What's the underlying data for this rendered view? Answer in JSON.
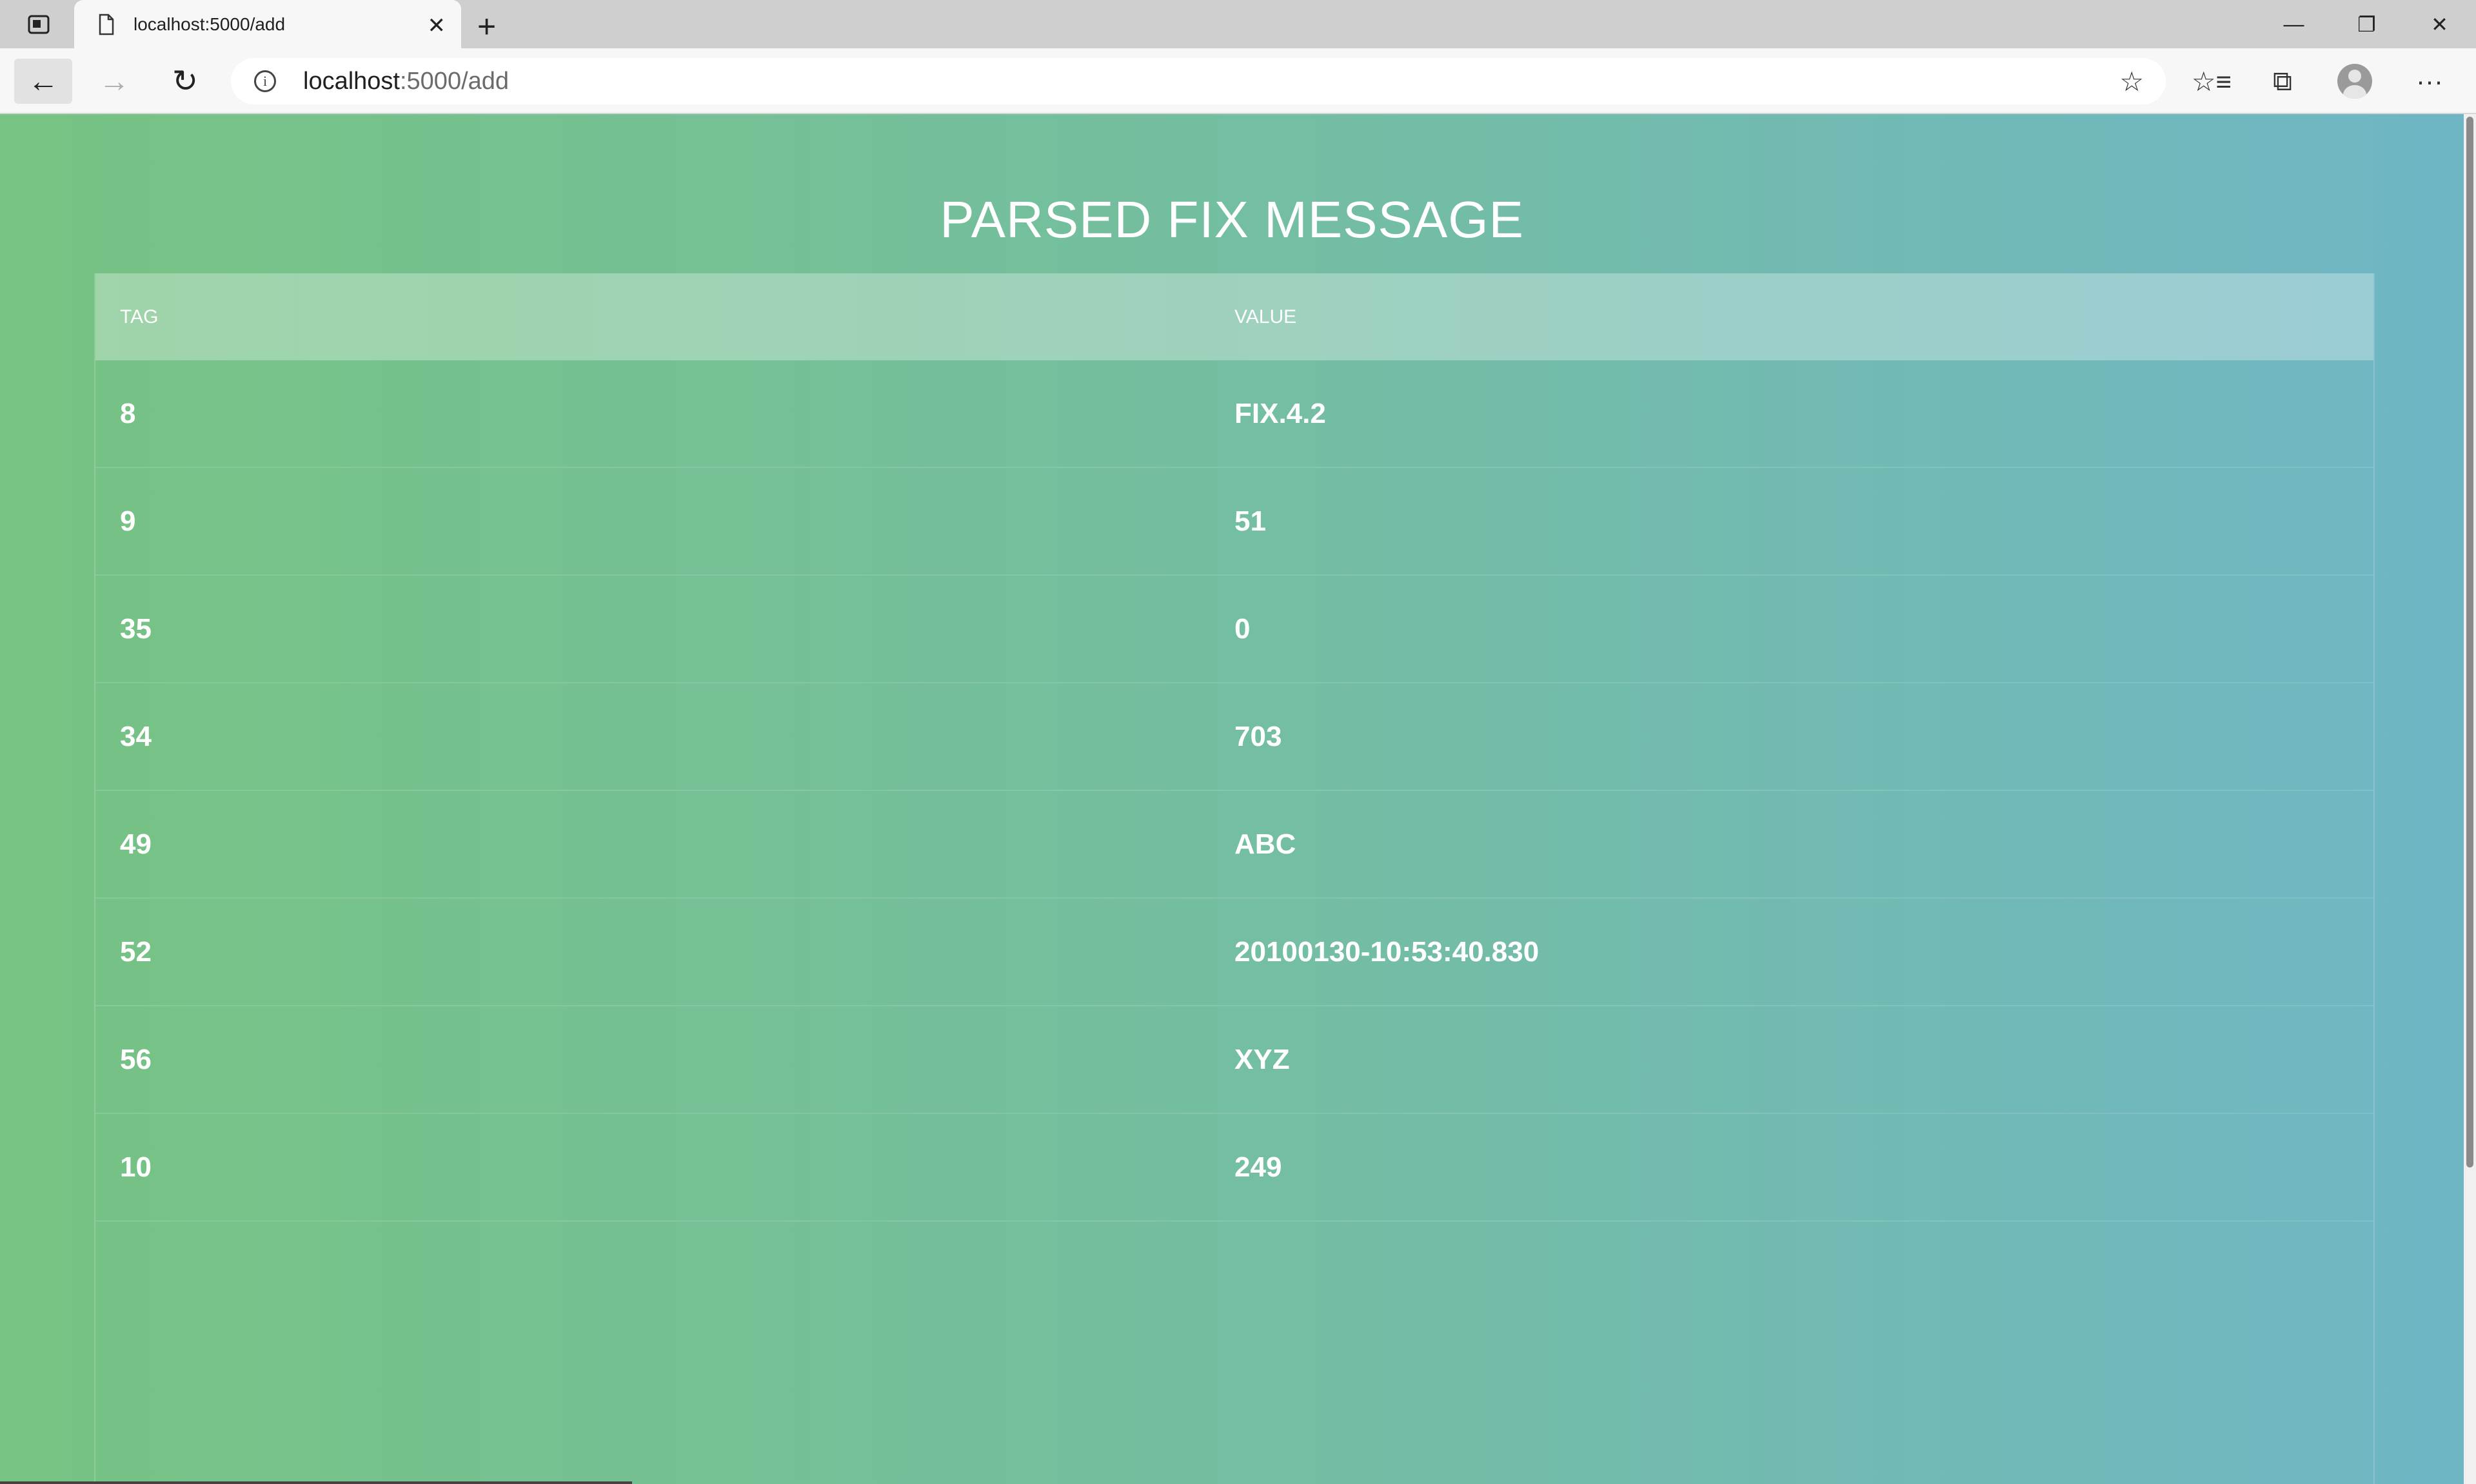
{
  "browser": {
    "tab_title": "localhost:5000/add",
    "close_glyph": "✕",
    "new_tab_glyph": "+",
    "window_controls": {
      "minimize": "—",
      "restore": "❐",
      "close": "✕"
    },
    "nav": {
      "back": "←",
      "forward": "→",
      "reload": "↻"
    },
    "address": {
      "host": "localhost",
      "path": ":5000/add",
      "info_glyph": "i"
    },
    "toolbar_icons": {
      "favorite_add": "☆",
      "favorites": "☆≡",
      "collections": "⧉",
      "more": "···"
    }
  },
  "page": {
    "title": "PARSED FIX MESSAGE",
    "table": {
      "headers": [
        "TAG",
        "VALUE"
      ],
      "rows": [
        {
          "tag": "8",
          "value": "FIX.4.2"
        },
        {
          "tag": "9",
          "value": "51"
        },
        {
          "tag": "35",
          "value": "0"
        },
        {
          "tag": "34",
          "value": "703"
        },
        {
          "tag": "49",
          "value": "ABC"
        },
        {
          "tag": "52",
          "value": "20100130-10:53:40.830"
        },
        {
          "tag": "56",
          "value": "XYZ"
        },
        {
          "tag": "10",
          "value": "249"
        }
      ]
    }
  },
  "colors": {
    "gradient_left": "#76c383",
    "gradient_right": "#6fb6c5",
    "text": "#ffffff"
  }
}
